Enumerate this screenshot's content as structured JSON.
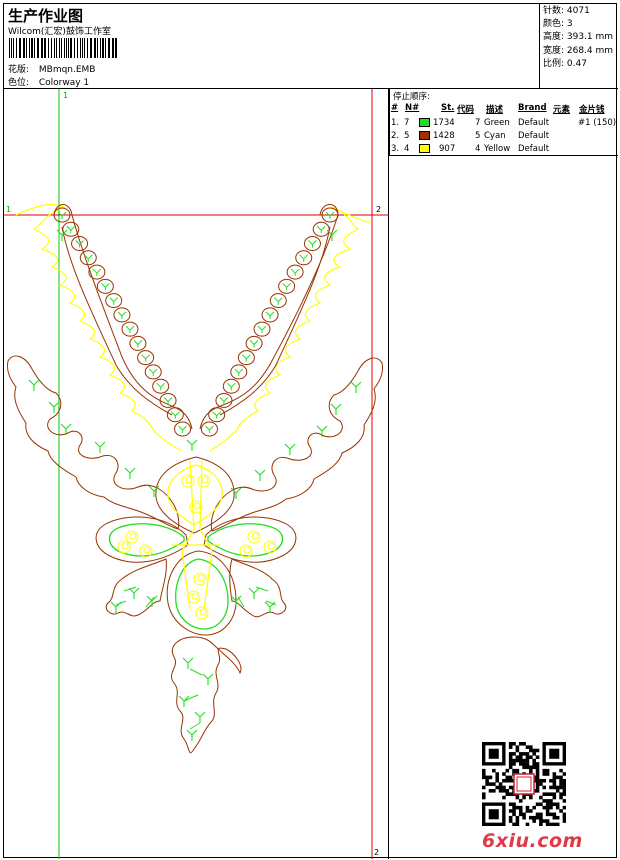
{
  "header": {
    "title": "生产作业图",
    "company": "Wilcom(汇宏)鼓饰工作室",
    "pattern_label": "花版:",
    "pattern_value": "MBmqn.EMB",
    "color_label": "色位:",
    "color_value": "Colorway 1"
  },
  "stats": {
    "stitches": "针数: 4071",
    "colors": "颜色: 3",
    "height": "高度: 393.1 mm",
    "width": "宽度: 268.4 mm",
    "scale": "比例: 0.47"
  },
  "stop_sequence": {
    "title": "停止顺序:",
    "columns": [
      "#",
      "N#",
      "St.",
      "代码",
      "描述",
      "Brand",
      "元素",
      "金片钱"
    ],
    "rows": [
      {
        "num": "1.",
        "n": "7",
        "swatch": "#22dd22",
        "st": "1734",
        "code": "7",
        "desc": "Green",
        "brand": "Default",
        "extra": "#1 (150)"
      },
      {
        "num": "2.",
        "n": "5",
        "swatch": "#993300",
        "st": "1428",
        "code": "5",
        "desc": "Cyan",
        "brand": "Default",
        "extra": ""
      },
      {
        "num": "3.",
        "n": "4",
        "swatch": "#ffff00",
        "st": "907",
        "code": "4",
        "desc": "Yellow",
        "brand": "Default",
        "extra": ""
      }
    ]
  },
  "guides": {
    "v1": "1",
    "v2_top": "2",
    "v2_bottom": "2",
    "h1": "1",
    "h2": "2"
  },
  "colors": {
    "green": "#22dd22",
    "brown": "#993300",
    "yellow": "#ffff00",
    "guide_green": "#00cc00",
    "guide_red": "#dd0000"
  },
  "footer": {
    "site": "6xiu.com"
  }
}
